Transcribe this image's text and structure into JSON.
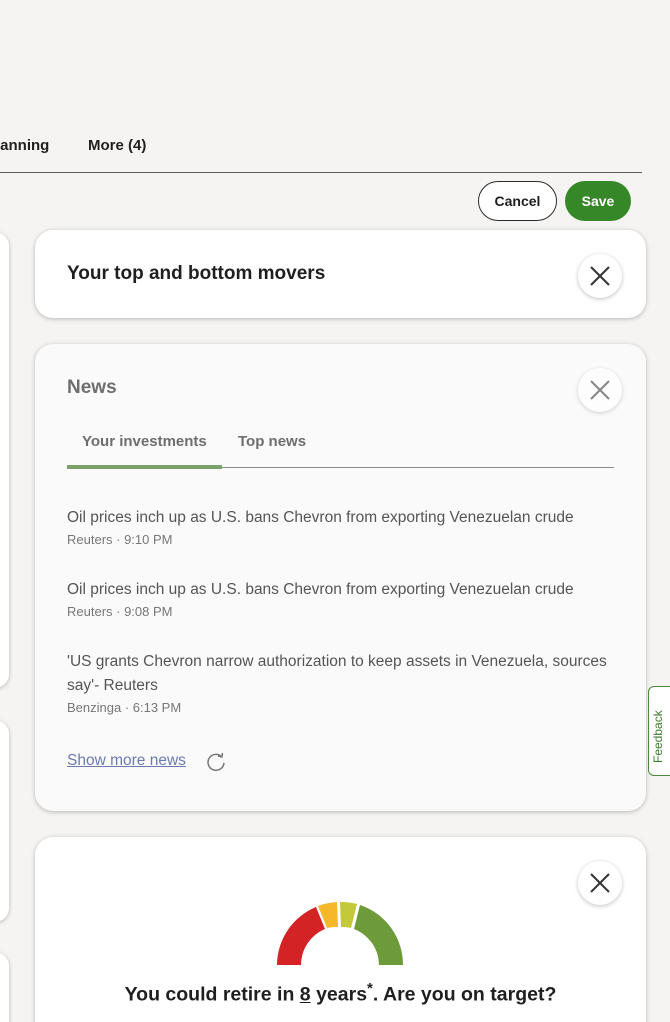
{
  "tabs": {
    "planning": "lanning",
    "more": "More (4)"
  },
  "actions": {
    "cancel": "Cancel",
    "save": "Save"
  },
  "movers_card": {
    "title": "Your top and bottom movers"
  },
  "news_card": {
    "title": "News",
    "tabs": [
      "Your investments",
      "Top news"
    ],
    "active_tab": "Your investments",
    "items": [
      {
        "headline": "Oil prices inch up as U.S. bans Chevron from exporting Venezuelan crude",
        "meta": "Reuters · 9:10 PM"
      },
      {
        "headline": "Oil prices inch up as U.S. bans Chevron from exporting Venezuelan crude",
        "meta": "Reuters · 9:08 PM"
      },
      {
        "headline": "'US grants Chevron narrow authorization to keep assets in Venezuela, sources say'- Reuters",
        "meta": "Benzinga · 6:13 PM"
      }
    ],
    "show_more": "Show more news"
  },
  "retirement_card": {
    "prefix": "You could retire in ",
    "years_value": "8",
    "years_suffix": " years",
    "star": "*",
    "suffix": ". Are you on target?"
  },
  "feedback": {
    "label": "Feedback"
  },
  "icons": {
    "close": "close-icon",
    "refresh": "refresh-icon"
  },
  "colors": {
    "primary_green": "#368727",
    "tab_indicator": "#7aa36b",
    "link": "#6b7bb0",
    "gauge": [
      "#d32325",
      "#f6b72a",
      "#c4c93a",
      "#6e9b3a"
    ]
  }
}
